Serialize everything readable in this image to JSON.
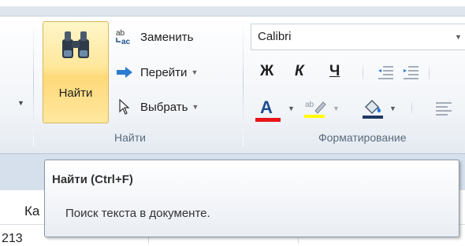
{
  "ribbon": {
    "find_group": {
      "big_button_label": "Найти",
      "replace_label": "Заменить",
      "goto_label": "Перейти",
      "select_label": "Выбрать",
      "group_label": "Найти"
    },
    "font_group": {
      "font_name": "Calibri",
      "bold_label": "Ж",
      "italic_label": "К",
      "underline_label": "Ч",
      "font_color_letter": "A",
      "group_label": "Форматирование"
    }
  },
  "document": {
    "column_header_partial": "Ка",
    "cell_partial": "213"
  },
  "tooltip": {
    "title": "Найти (Ctrl+F)",
    "description": "Поиск текста в документе."
  },
  "colors": {
    "font_color_bar": "#e8141c",
    "highlight_bar": "#ffff00",
    "fill_bar": "#1f3864",
    "button_highlight": "#ffe79b"
  }
}
